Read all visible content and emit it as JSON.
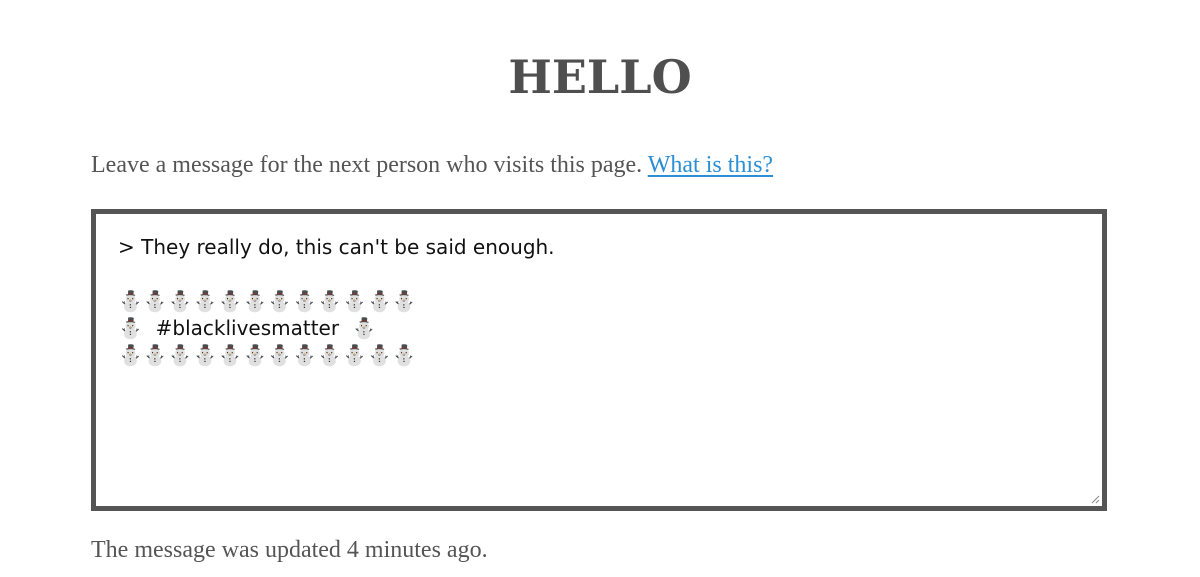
{
  "page": {
    "title": "HELLO"
  },
  "intro": {
    "text": "Leave a message for the next person who visits this page. ",
    "link_label": "What is this?"
  },
  "message": {
    "value": "> They really do, this can't be said enough.\n\n⛄⛄⛄⛄⛄⛄⛄⛄⛄⛄⛄⛄\n⛄  #blacklivesmatter  ⛄\n⛄⛄⛄⛄⛄⛄⛄⛄⛄⛄⛄⛄"
  },
  "status": {
    "text": "The message was updated 4 minutes ago."
  },
  "colors": {
    "text": "#555555",
    "link": "#2b8fd6",
    "border": "#555555"
  }
}
